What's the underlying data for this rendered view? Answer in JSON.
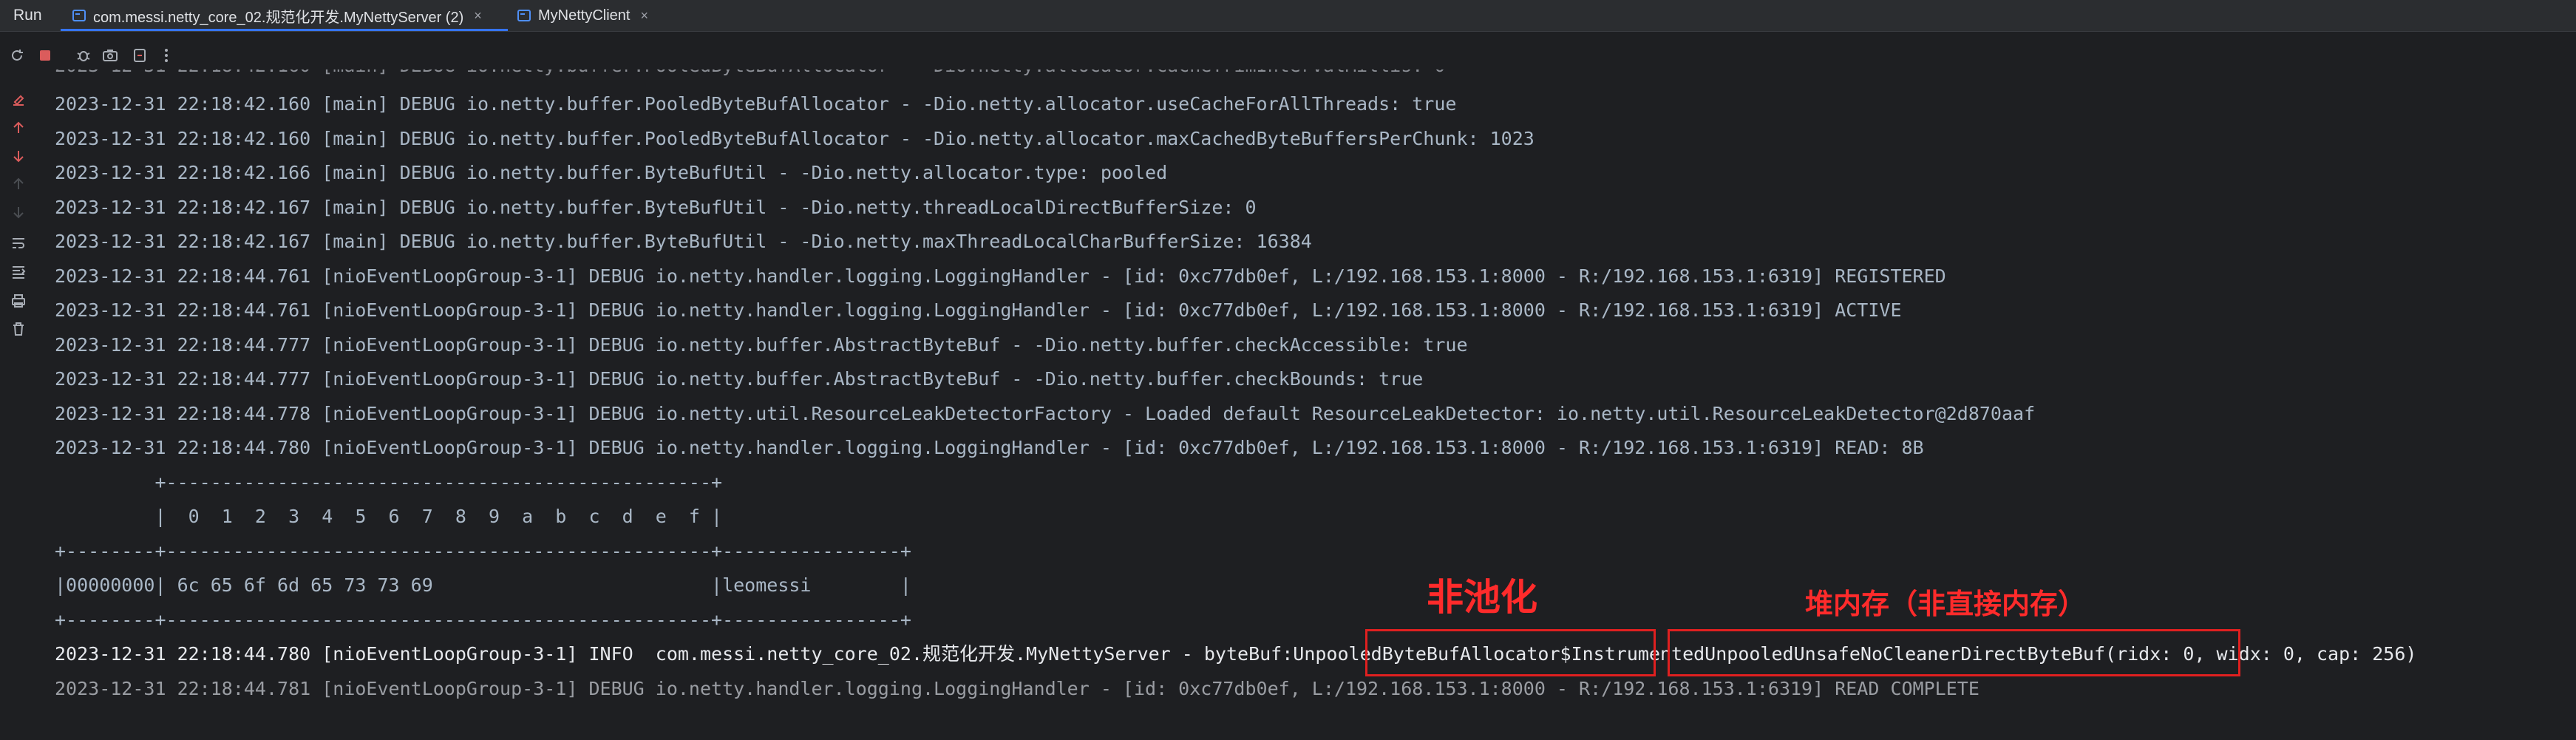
{
  "tabbar": {
    "run_label": "Run",
    "tabs": [
      {
        "label": "com.messi.netty_core_02.规范化开发.MyNettyServer (2)",
        "close": "×"
      },
      {
        "label": "MyNettyClient",
        "close": "×"
      }
    ]
  },
  "colors": {
    "background": "#1e1f22",
    "text": "#a9b7c6",
    "annotation_red": "#e02020",
    "active_tab_accent": "#3574f0"
  },
  "toolbar_icons": [
    "rerun-icon",
    "stop-icon",
    "debug-icon",
    "screenshot-icon",
    "pin-icon",
    "more-icon",
    "clear-icon",
    "up-arrow-icon",
    "down-arrow-icon",
    "up-arrow-disabled-icon",
    "down-arrow-disabled-icon",
    "soft-wrap-icon",
    "scroll-to-end-icon",
    "print-icon",
    "trash-icon"
  ],
  "console": {
    "lines": [
      "2023-12-31 22:18:42.160 [main] DEBUG io.netty.buffer.PooledByteBufAllocator - -Dio.netty.allocator.useCacheForAllThreads: true",
      "2023-12-31 22:18:42.160 [main] DEBUG io.netty.buffer.PooledByteBufAllocator - -Dio.netty.allocator.maxCachedByteBuffersPerChunk: 1023",
      "2023-12-31 22:18:42.166 [main] DEBUG io.netty.buffer.ByteBufUtil - -Dio.netty.allocator.type: pooled",
      "2023-12-31 22:18:42.167 [main] DEBUG io.netty.buffer.ByteBufUtil - -Dio.netty.threadLocalDirectBufferSize: 0",
      "2023-12-31 22:18:42.167 [main] DEBUG io.netty.buffer.ByteBufUtil - -Dio.netty.maxThreadLocalCharBufferSize: 16384",
      "2023-12-31 22:18:44.761 [nioEventLoopGroup-3-1] DEBUG io.netty.handler.logging.LoggingHandler - [id: 0xc77db0ef, L:/192.168.153.1:8000 - R:/192.168.153.1:6319] REGISTERED",
      "2023-12-31 22:18:44.761 [nioEventLoopGroup-3-1] DEBUG io.netty.handler.logging.LoggingHandler - [id: 0xc77db0ef, L:/192.168.153.1:8000 - R:/192.168.153.1:6319] ACTIVE",
      "2023-12-31 22:18:44.777 [nioEventLoopGroup-3-1] DEBUG io.netty.buffer.AbstractByteBuf - -Dio.netty.buffer.checkAccessible: true",
      "2023-12-31 22:18:44.777 [nioEventLoopGroup-3-1] DEBUG io.netty.buffer.AbstractByteBuf - -Dio.netty.buffer.checkBounds: true",
      "2023-12-31 22:18:44.778 [nioEventLoopGroup-3-1] DEBUG io.netty.util.ResourceLeakDetectorFactory - Loaded default ResourceLeakDetector: io.netty.util.ResourceLeakDetector@2d870aaf",
      "2023-12-31 22:18:44.780 [nioEventLoopGroup-3-1] DEBUG io.netty.handler.logging.LoggingHandler - [id: 0xc77db0ef, L:/192.168.153.1:8000 - R:/192.168.153.1:6319] READ: 8B",
      "         +-------------------------------------------------+",
      "         |  0  1  2  3  4  5  6  7  8  9  a  b  c  d  e  f |",
      "+--------+-------------------------------------------------+----------------+",
      "|00000000| 6c 65 6f 6d 65 73 73 69                         |leomessi        |",
      "+--------+-------------------------------------------------+----------------+",
      "2023-12-31 22:18:44.780 [nioEventLoopGroup-3-1] INFO  com.messi.netty_core_02.规范化开发.MyNettyServer - byteBuf:UnpooledByteBufAllocator$InstrumentedUnpooledUnsafeNoCleanerDirectByteBuf(ridx: 0, widx: 0, cap: 256)",
      "2023-12-31 22:18:44.781 [nioEventLoopGroup-3-1] DEBUG io.netty.handler.logging.LoggingHandler - [id: 0xc77db0ef, L:/192.168.153.1:8000 - R:/192.168.153.1:6319] READ COMPLETE"
    ]
  },
  "annotations": {
    "unpooled_label": "非池化",
    "heap_label": "堆内存（非直接内存）"
  }
}
